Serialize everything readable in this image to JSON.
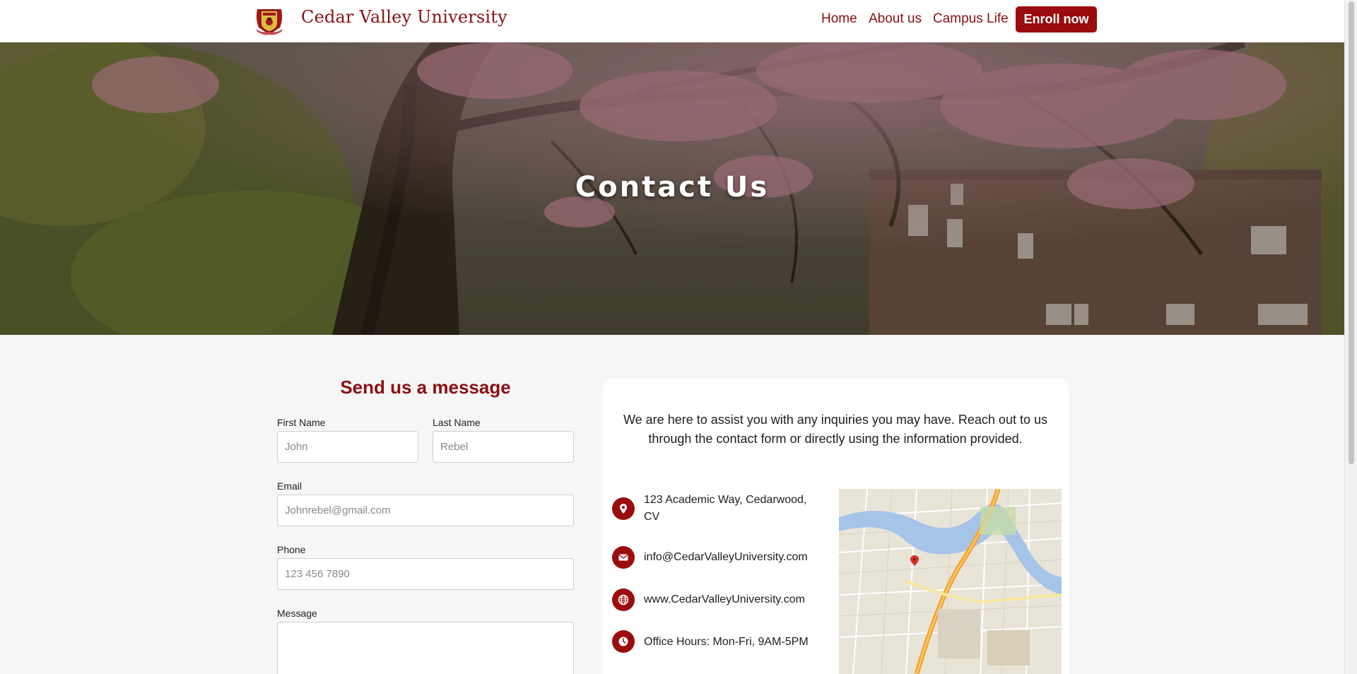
{
  "header": {
    "brand": "Cedar Valley University",
    "nav": [
      {
        "label": "Home"
      },
      {
        "label": "About us"
      },
      {
        "label": "Campus Life"
      }
    ],
    "cta": "Enroll now"
  },
  "hero": {
    "title": "Contact Us"
  },
  "form": {
    "title": "Send us a message",
    "first_name": {
      "label": "First Name",
      "placeholder": "John"
    },
    "last_name": {
      "label": "Last Name",
      "placeholder": "Rebel"
    },
    "email": {
      "label": "Email",
      "placeholder": "Johnrebel@gmail.com"
    },
    "phone": {
      "label": "Phone",
      "placeholder": "123 456 7890"
    },
    "message": {
      "label": "Message",
      "placeholder": ""
    }
  },
  "contact": {
    "intro": "We are here to assist you with any inquiries you may have. Reach out to us through the contact form or directly using the information provided.",
    "items": [
      {
        "icon": "location-pin-icon",
        "text": "123 Academic Way, Cedarwood, CV"
      },
      {
        "icon": "envelope-icon",
        "text": "info@CedarValleyUniversity.com"
      },
      {
        "icon": "globe-icon",
        "text": "www.CedarValleyUniversity.com"
      },
      {
        "icon": "clock-icon",
        "text": "Office Hours: Mon-Fri, 9AM-5PM"
      }
    ]
  },
  "colors": {
    "brand": "#8b0f12",
    "button": "#9a0c0e",
    "page_bg": "#f6f6f6"
  }
}
